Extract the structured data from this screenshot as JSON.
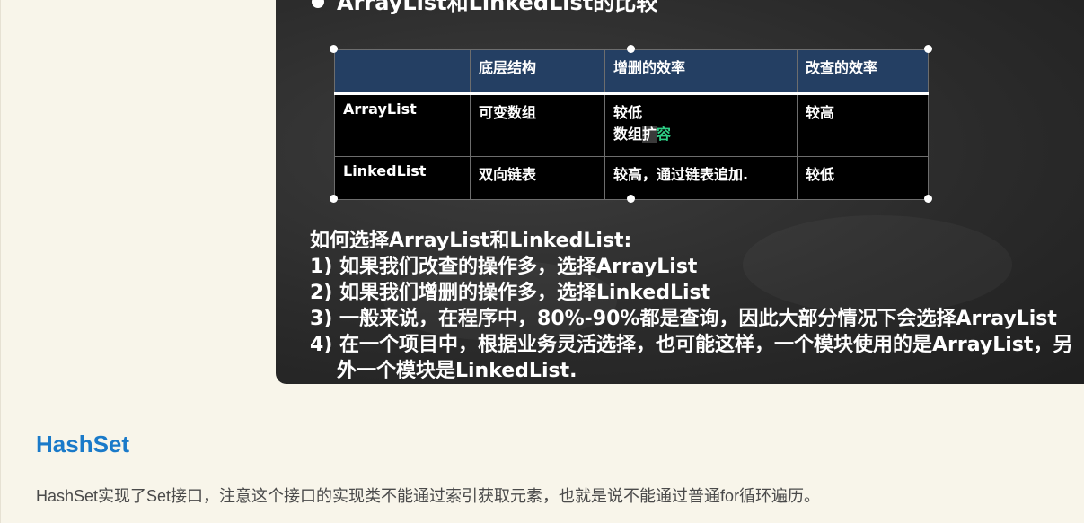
{
  "slide": {
    "heading": "ArrayList和LinkedList的比较",
    "table": {
      "headers": [
        "",
        "底层结构",
        "增删的效率",
        "改查的效率"
      ],
      "rows": [
        {
          "name": "ArrayList",
          "structure": "可变数组",
          "add_remove_line1": "较低",
          "add_remove_line2_a": "数组",
          "add_remove_line2_b": "扩",
          "add_remove_line2_c": "容",
          "query": "较高"
        },
        {
          "name": "LinkedList",
          "structure": "双向链表",
          "add_remove": "较高，通过链表追加.",
          "query": "较低"
        }
      ]
    },
    "notes": [
      "如何选择ArrayList和LinkedList:",
      "1) 如果我们改查的操作多，选择ArrayList",
      "2) 如果我们增删的操作多，选择LinkedList",
      "3) 一般来说，在程序中，80%-90%都是查询，因此大部分情况下会选择ArrayList",
      "4) 在一个项目中，根据业务灵活选择，也可能这样，一个模块使用的是ArrayList，另",
      "外一个模块是LinkedList."
    ]
  },
  "section": {
    "title": "HashSet",
    "paragraph": "HashSet实现了Set接口，注意这个接口的实现类不能通过索引获取元素，也就是说不能通过普通for循环遍历。"
  },
  "colors": {
    "slide_bg": "#2b2b2b",
    "table_header_bg": "#243f63",
    "link_blue": "#1a7ac9",
    "page_bg": "#f8f5ea",
    "highlight_green": "#2ecf86"
  }
}
